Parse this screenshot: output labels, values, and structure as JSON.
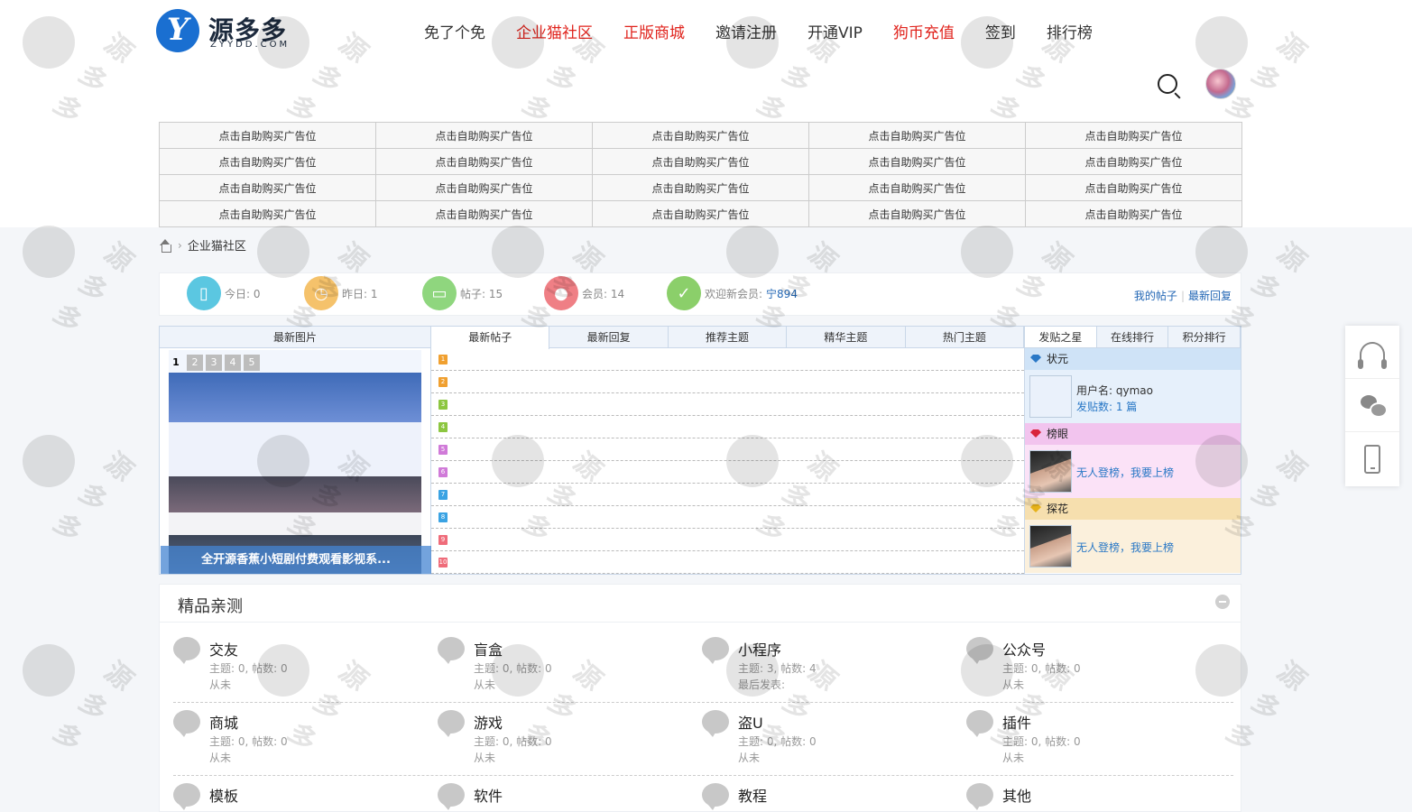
{
  "logo": {
    "text": "源多多",
    "sub": "ZYYDD.COM"
  },
  "nav": [
    {
      "label": "免了个免",
      "color": "#333333"
    },
    {
      "label": "企业猫社区",
      "color": "#e0231c"
    },
    {
      "label": "正版商城",
      "color": "#e0231c"
    },
    {
      "label": "邀请注册",
      "color": "#333333"
    },
    {
      "label": "开通VIP",
      "color": "#333333"
    },
    {
      "label": "狗币充值",
      "color": "#e0231c"
    },
    {
      "label": "签到",
      "color": "#333333"
    },
    {
      "label": "排行榜",
      "color": "#333333"
    }
  ],
  "ads": {
    "cell_label": "点击自助购买广告位",
    "rows": 4,
    "cols": 5
  },
  "breadcrumb": {
    "current": "企业猫社区"
  },
  "stats": {
    "today": "今日: 0",
    "yesterday": "昨日: 1",
    "posts": "帖子: 15",
    "members": "会员: 14",
    "welcome_label": "欢迎新会员:",
    "welcome_user": "宁894",
    "my_posts": "我的帖子",
    "latest_reply": "最新回复",
    "colors": {
      "today": "#5bc7e1",
      "yesterday": "#f5c26b",
      "posts": "#8fd67e",
      "members": "#ef7f85",
      "welcome": "#8bcf6a"
    }
  },
  "panel": {
    "pic_header": "最新图片",
    "pic_pages": [
      "1",
      "2",
      "3",
      "4",
      "5"
    ],
    "pic_caption": "全开源香蕉小短剧付费观看影视系...",
    "post_tabs": [
      "最新帖子",
      "最新回复",
      "推荐主题",
      "精华主题",
      "热门主题"
    ],
    "post_numbers": [
      "1",
      "2",
      "3",
      "4",
      "5",
      "6",
      "7",
      "8",
      "9",
      "10"
    ],
    "num_colors": [
      "#f0a030",
      "#f0a030",
      "#8cc640",
      "#8cc640",
      "#d07ad8",
      "#d07ad8",
      "#3aa3e3",
      "#3aa3e3",
      "#ef6c7a",
      "#ef6c7a"
    ],
    "star_tabs": [
      "发贴之星",
      "在线排行",
      "积分排行"
    ],
    "ranks": [
      {
        "title": "状元",
        "head_bg": "#cfe3f7",
        "body_bg": "#e6f0fb",
        "gem": "#2a78c6",
        "user_label": "用户名: qymao",
        "count_label": "发贴数: 1 篇"
      },
      {
        "title": "榜眼",
        "head_bg": "#f2c4ee",
        "body_bg": "#fbe2f7",
        "gem": "#d8243c",
        "link": "无人登榜，我要上榜"
      },
      {
        "title": "探花",
        "head_bg": "#f6dfae",
        "body_bg": "#fbf0dc",
        "gem": "#e6b21a",
        "link": "无人登榜，我要上榜"
      }
    ]
  },
  "section": {
    "title": "精品亲测",
    "forums": [
      {
        "name": "交友",
        "meta": "主题: 0, 帖数: 0",
        "last": "从未"
      },
      {
        "name": "盲盒",
        "meta": "主题: 0, 帖数: 0",
        "last": "从未"
      },
      {
        "name": "小程序",
        "meta": "主题: 3, 帖数: 4",
        "last": "最后发表:"
      },
      {
        "name": "公众号",
        "meta": "主题: 0, 帖数: 0",
        "last": "从未"
      },
      {
        "name": "商城",
        "meta": "主题: 0, 帖数: 0",
        "last": "从未"
      },
      {
        "name": "游戏",
        "meta": "主题: 0, 帖数: 0",
        "last": "从未"
      },
      {
        "name": "盗U",
        "meta": "主题: 0, 帖数: 0",
        "last": "从未"
      },
      {
        "name": "插件",
        "meta": "主题: 0, 帖数: 0",
        "last": "从未"
      },
      {
        "name": "模板",
        "meta": "",
        "last": ""
      },
      {
        "name": "软件",
        "meta": "",
        "last": ""
      },
      {
        "name": "教程",
        "meta": "",
        "last": ""
      },
      {
        "name": "其他",
        "meta": "",
        "last": ""
      }
    ]
  },
  "side_tools": [
    "headset-icon",
    "wechat-icon",
    "phone-icon"
  ]
}
